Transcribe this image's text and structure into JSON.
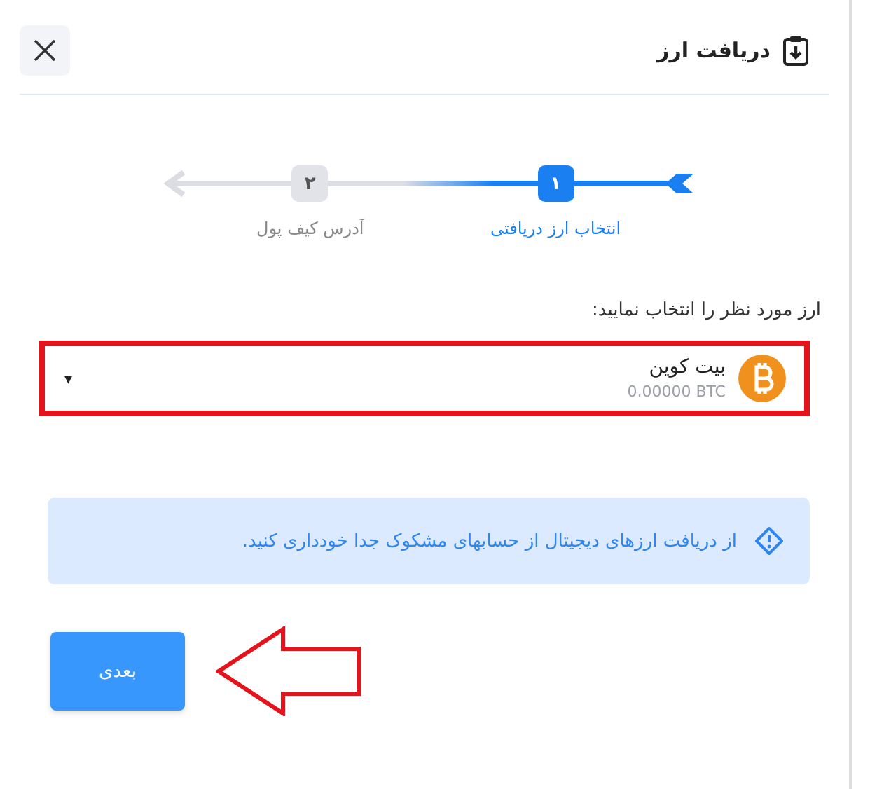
{
  "dialog": {
    "title": "دریافت ارز"
  },
  "steps": [
    {
      "number": "۱",
      "label": "انتخاب ارز دریافتی",
      "selected": true
    },
    {
      "number": "۲",
      "label": "آدرس کیف پول",
      "selected": false
    }
  ],
  "select": {
    "label": "ارز مورد نظر را انتخاب نمایید:",
    "value": "بیت کوین",
    "balance": "0.00000 BTC",
    "caret": "▾",
    "highlighted": true
  },
  "alert": {
    "text": "از دریافت ارزهای دیجیتال از حسابهای مشکوک جدا خودداری کنید."
  },
  "next_button": {
    "label": "بعدی",
    "pointer_arrow": true
  }
}
